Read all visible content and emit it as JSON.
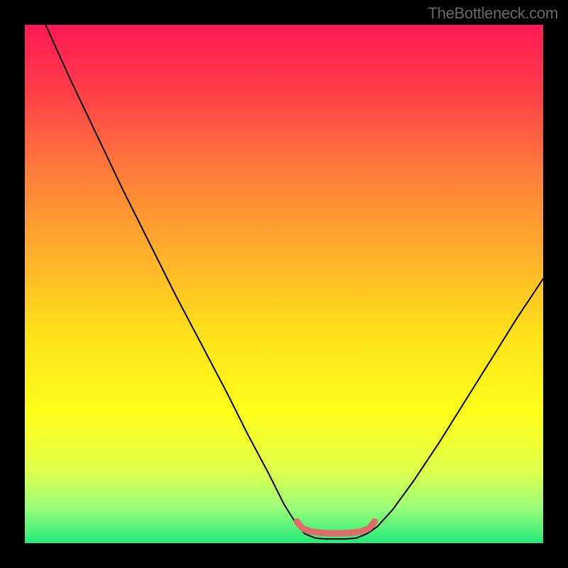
{
  "watermark": "TheBottleneck.com",
  "chart_data": {
    "type": "line",
    "title": "",
    "xlabel": "",
    "ylabel": "",
    "xlim": [
      0,
      100
    ],
    "ylim": [
      0,
      100
    ],
    "background_gradient": {
      "stops": [
        {
          "offset": 0.0,
          "color": "#ff1a55"
        },
        {
          "offset": 0.12,
          "color": "#ff3b4a"
        },
        {
          "offset": 0.28,
          "color": "#ff7b3a"
        },
        {
          "offset": 0.45,
          "color": "#ffb22a"
        },
        {
          "offset": 0.6,
          "color": "#ffe21a"
        },
        {
          "offset": 0.75,
          "color": "#fdff1a"
        },
        {
          "offset": 0.86,
          "color": "#e0ff4a"
        },
        {
          "offset": 0.93,
          "color": "#9cff7a"
        },
        {
          "offset": 1.0,
          "color": "#25e97b"
        }
      ]
    },
    "series": [
      {
        "name": "bottleneck-curve",
        "color": "#000000",
        "stroke_width": 2,
        "points": [
          {
            "x": 4.0,
            "y": 100.0
          },
          {
            "x": 9.0,
            "y": 89.0
          },
          {
            "x": 14.0,
            "y": 78.5
          },
          {
            "x": 19.0,
            "y": 68.0
          },
          {
            "x": 24.0,
            "y": 58.0
          },
          {
            "x": 29.0,
            "y": 48.0
          },
          {
            "x": 34.0,
            "y": 38.5
          },
          {
            "x": 39.0,
            "y": 29.0
          },
          {
            "x": 43.0,
            "y": 21.0
          },
          {
            "x": 47.0,
            "y": 13.5
          },
          {
            "x": 50.0,
            "y": 7.5
          },
          {
            "x": 52.5,
            "y": 3.5
          },
          {
            "x": 54.0,
            "y": 1.8
          },
          {
            "x": 56.0,
            "y": 1.0
          },
          {
            "x": 58.0,
            "y": 0.8
          },
          {
            "x": 60.0,
            "y": 0.8
          },
          {
            "x": 62.0,
            "y": 0.8
          },
          {
            "x": 64.0,
            "y": 1.0
          },
          {
            "x": 66.0,
            "y": 1.8
          },
          {
            "x": 68.0,
            "y": 3.2
          },
          {
            "x": 71.0,
            "y": 6.5
          },
          {
            "x": 75.0,
            "y": 12.0
          },
          {
            "x": 80.0,
            "y": 19.5
          },
          {
            "x": 85.0,
            "y": 27.5
          },
          {
            "x": 90.0,
            "y": 35.5
          },
          {
            "x": 95.0,
            "y": 43.5
          },
          {
            "x": 100.0,
            "y": 51.0
          }
        ]
      },
      {
        "name": "optimal-zone-marker",
        "color": "#e06b6b",
        "stroke_width": 9,
        "points": [
          {
            "x": 52.5,
            "y": 4.2
          },
          {
            "x": 53.0,
            "y": 3.5
          },
          {
            "x": 53.7,
            "y": 2.8
          },
          {
            "x": 55.0,
            "y": 2.3
          },
          {
            "x": 57.0,
            "y": 2.0
          },
          {
            "x": 59.0,
            "y": 1.9
          },
          {
            "x": 61.0,
            "y": 1.9
          },
          {
            "x": 63.0,
            "y": 2.0
          },
          {
            "x": 65.0,
            "y": 2.3
          },
          {
            "x": 66.3,
            "y": 2.8
          },
          {
            "x": 67.0,
            "y": 3.5
          },
          {
            "x": 67.5,
            "y": 4.2
          }
        ]
      }
    ]
  }
}
